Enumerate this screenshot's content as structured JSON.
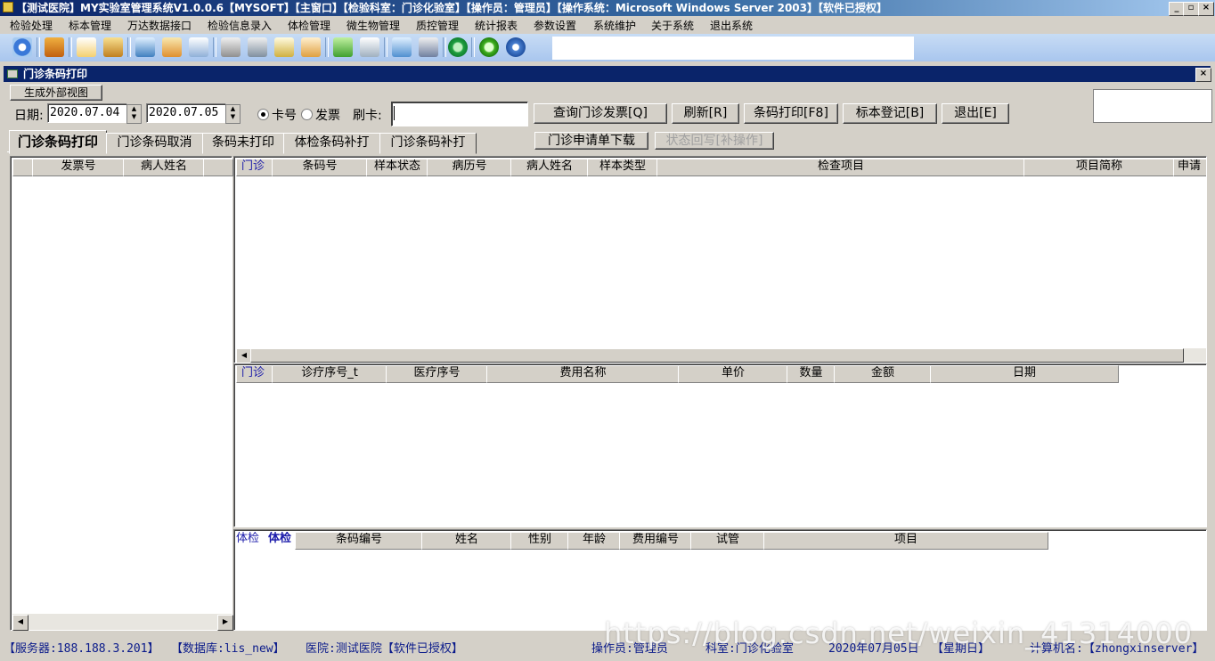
{
  "window": {
    "title": "【测试医院】MY实验室管理系统V1.0.0.6【MYSOFT】【主窗口】【检验科室：门诊化验室】【操作员：管理员】【操作系统：Microsoft Windows Server 2003】【软件已授权】",
    "min": "_",
    "max": "▫",
    "close": "×"
  },
  "menu": [
    "检验处理",
    "标本管理",
    "万达数据接口",
    "检验信息录入",
    "体检管理",
    "微生物管理",
    "质控管理",
    "统计报表",
    "参数设置",
    "系统维护",
    "关于系统",
    "退出系统"
  ],
  "child": {
    "title": "门诊条码打印",
    "close": "×",
    "gen_view": "生成外部视图"
  },
  "filter": {
    "date_label": "日期:",
    "date_from": "2020.07.04",
    "date_to": "2020.07.05",
    "radio_card": "卡号",
    "radio_invoice": "发票",
    "swipe_label": "刷卡:",
    "swipe_value": ""
  },
  "buttons": {
    "query": "查询门诊发票[Q]",
    "refresh": "刷新[R]",
    "print": "条码打印[F8]",
    "register": "标本登记[B]",
    "exit": "退出[E]",
    "download": "门诊申请单下载",
    "writeback": "状态回写[补操作]"
  },
  "tabs": [
    "门诊条码打印",
    "门诊条码取消",
    "条码未打印",
    "体检条码补打",
    "门诊条码补打"
  ],
  "left_grid": {
    "columns": [
      "发票号",
      "病人姓名"
    ]
  },
  "top_grid": {
    "columns": [
      "门诊",
      "条码号",
      "样本状态",
      "病历号",
      "病人姓名",
      "样本类型",
      "检查项目",
      "项目简称",
      "申请"
    ]
  },
  "mid_grid": {
    "columns": [
      "门诊",
      "诊疗序号_t",
      "医疗序号",
      "费用名称",
      "单价",
      "数量",
      "金额",
      "日期"
    ]
  },
  "bottom_grid": {
    "columns": [
      "体检",
      "体检",
      "条码编号",
      "姓名",
      "性别",
      "年龄",
      "费用编号",
      "试管",
      "项目"
    ]
  },
  "status": {
    "server": "【服务器:188.188.3.201】",
    "db": "【数据库:lis_new】",
    "hospital": "医院:测试医院【软件已授权】",
    "operator": "操作员:管理员",
    "dept": "科室:门诊化验室",
    "date": "2020年07月05日",
    "weekday": "【星期日】",
    "computer": "计算机名:【zhongxinserver】"
  },
  "watermark": "https://blog.csdn.net/weixin_41314000"
}
